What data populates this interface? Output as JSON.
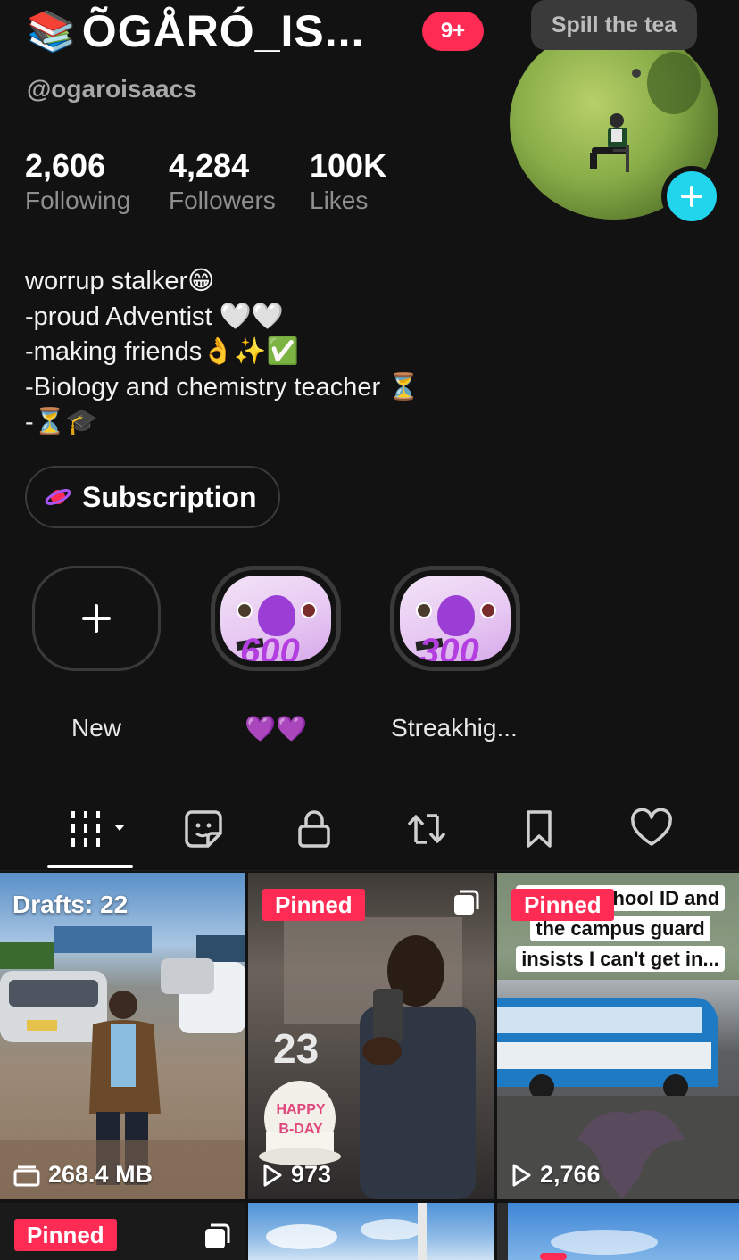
{
  "profile": {
    "books_emoji": "📚",
    "display_name": "ÕGÅRÓ_IS...",
    "notification_badge": "9+",
    "handle": "@ogaroisaacs",
    "note_bubble": "Spill the tea"
  },
  "stats": [
    {
      "value": "2,606",
      "label": "Following"
    },
    {
      "value": "4,284",
      "label": "Followers"
    },
    {
      "value": "100K",
      "label": "Likes"
    }
  ],
  "bio": {
    "line1": "worrup stalker😁",
    "line2": "-proud Adventist 🤍🤍",
    "line3": "-making friends👌✨✅",
    "line4": "-Biology and chemistry teacher ⏳",
    "line5": "-⏳🎓"
  },
  "subscription": {
    "label": "Subscription"
  },
  "highlights": [
    {
      "label": "New"
    },
    {
      "label": "💜💜",
      "number": "600"
    },
    {
      "label": "Streakhig...",
      "number": "300"
    }
  ],
  "tabs": [
    "videos-grid",
    "favorites-sticker",
    "private-lock",
    "reposts",
    "saved",
    "liked"
  ],
  "grid": {
    "cell1": {
      "drafts": "Drafts: 22",
      "size": "268.4 MB"
    },
    "cell2": {
      "pinned": "Pinned",
      "views": "973",
      "overlay_number": "23",
      "cake_text": "HAPPY B-DAY"
    },
    "cell3": {
      "pinned": "Pinned",
      "views": "2,766",
      "caption": "got my school ID and the campus guard insists I can't get in..."
    },
    "cell4": {
      "pinned": "Pinned"
    }
  },
  "colors": {
    "accent": "#fe2c55",
    "plus_blue": "#20d5ec",
    "background": "#121212"
  }
}
